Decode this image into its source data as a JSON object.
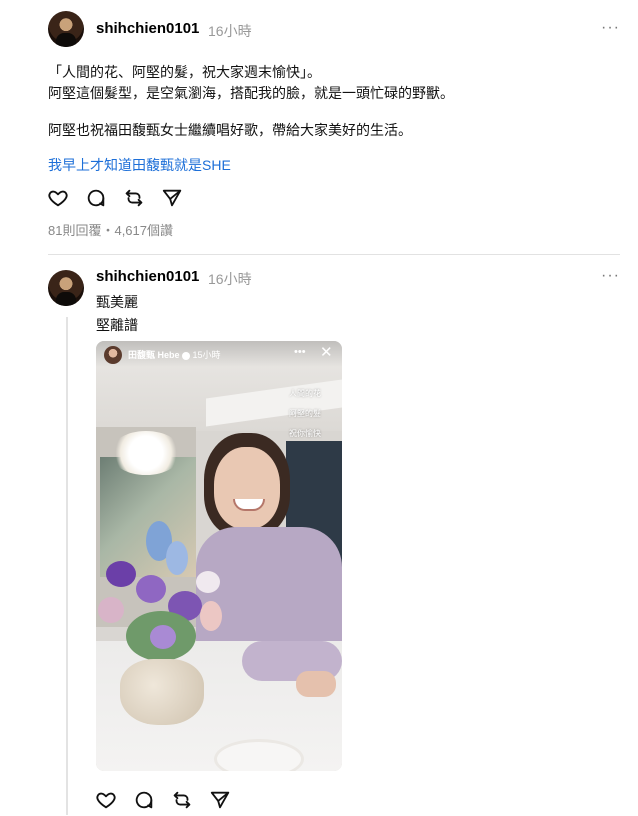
{
  "post": {
    "username": "shihchien0101",
    "time": "16小時",
    "more": "···",
    "lines": [
      "「人間的花、阿堅的髮，祝大家週末愉快」。",
      "阿堅這個髮型，是空氣瀏海，搭配我的臉，就是一頭忙碌的野獸。",
      "阿堅也祝福田馥甄女士繼續唱好歌，帶給大家美好的生活。"
    ],
    "link": "我早上才知道田馥甄就是SHE",
    "stats": "81則回覆・4,617個讚"
  },
  "reply": {
    "username": "shihchien0101",
    "time": "16小時",
    "more": "···",
    "lines": [
      "甄美麗",
      "堅離譜"
    ]
  },
  "story": {
    "name": "田馥甄 Hebe",
    "time": "15小時",
    "more": "•••",
    "close": "✕",
    "texts": [
      "人間的花",
      "阿堅的髮",
      "祝你愉快"
    ]
  },
  "icons": {
    "like": "heart-icon",
    "reply": "comment-icon",
    "repost": "repost-icon",
    "share": "send-icon"
  }
}
